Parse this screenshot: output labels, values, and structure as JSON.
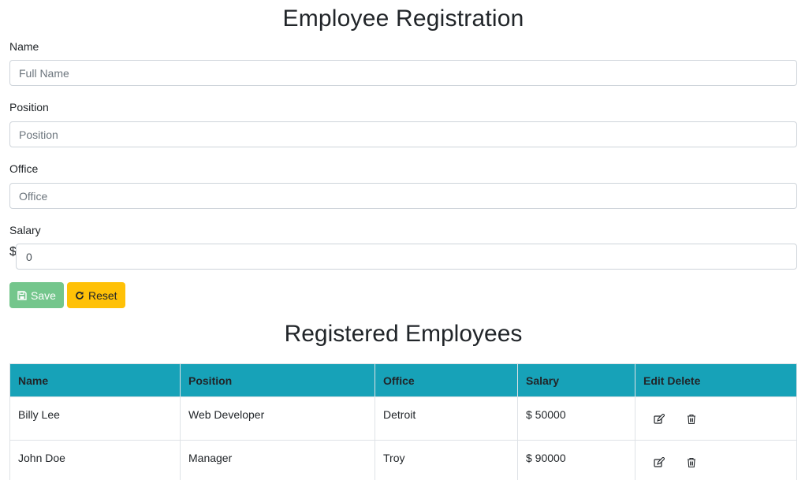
{
  "form": {
    "title": "Employee Registration",
    "name": {
      "label": "Name",
      "placeholder": "Full Name",
      "value": ""
    },
    "position": {
      "label": "Position",
      "placeholder": "Position",
      "value": ""
    },
    "office": {
      "label": "Office",
      "placeholder": "Office",
      "value": ""
    },
    "salary": {
      "label": "Salary",
      "prefix": "$",
      "value": "0"
    },
    "save_label": "Save",
    "reset_label": "Reset",
    "colors": {
      "save": "#74c68c",
      "reset": "#ffc107"
    }
  },
  "table": {
    "title": "Registered Employees",
    "header_color": "#17a2b8",
    "columns": [
      "Name",
      "Position",
      "Office",
      "Salary",
      "Edit Delete"
    ],
    "rows": [
      {
        "name": "Billy Lee",
        "position": "Web Developer",
        "office": "Detroit",
        "salary": "$ 50000"
      },
      {
        "name": "John Doe",
        "position": "Manager",
        "office": "Troy",
        "salary": "$ 90000"
      }
    ],
    "row_icons": [
      "edit-icon",
      "trash-icon"
    ]
  }
}
